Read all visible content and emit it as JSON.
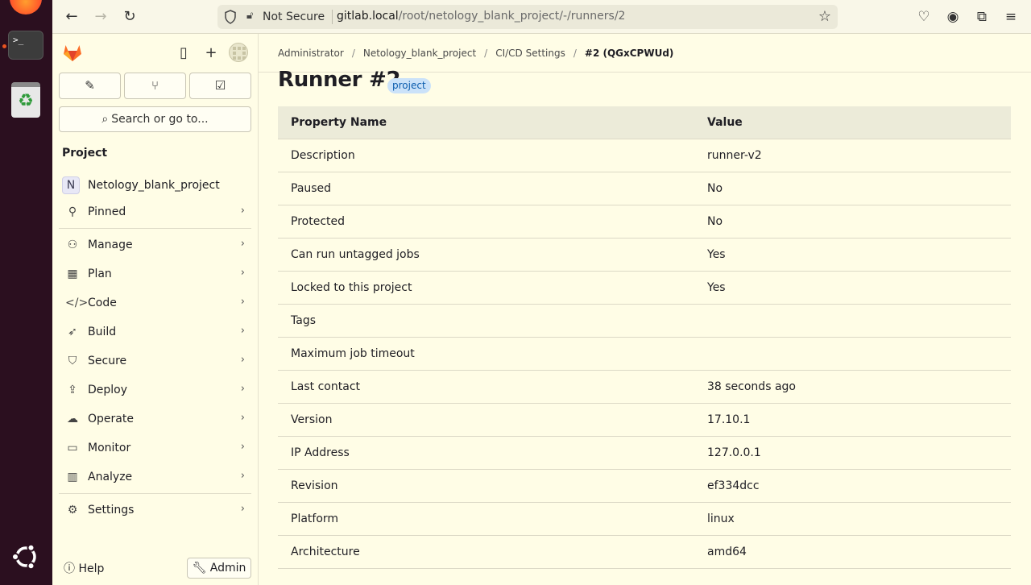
{
  "browser": {
    "security_label": "Not Secure",
    "url_host": "gitlab.local",
    "url_path": "/root/netology_blank_project/-/runners/2"
  },
  "sidebar": {
    "search_label": "Search or go to...",
    "section_heading": "Project",
    "project_initial": "N",
    "project_name": "Netology_blank_project",
    "items": [
      {
        "label": "Pinned",
        "icon": "pin-icon"
      },
      {
        "label": "Manage",
        "icon": "users-icon"
      },
      {
        "label": "Plan",
        "icon": "calendar-icon"
      },
      {
        "label": "Code",
        "icon": "code-icon"
      },
      {
        "label": "Build",
        "icon": "rocket-icon"
      },
      {
        "label": "Secure",
        "icon": "shield-icon"
      },
      {
        "label": "Deploy",
        "icon": "deploy-icon"
      },
      {
        "label": "Operate",
        "icon": "cloud-gear-icon"
      },
      {
        "label": "Monitor",
        "icon": "monitor-icon"
      },
      {
        "label": "Analyze",
        "icon": "chart-icon"
      },
      {
        "label": "Settings",
        "icon": "gear-icon"
      }
    ],
    "help_label": "Help",
    "admin_label": "Admin"
  },
  "breadcrumbs": [
    "Administrator",
    "Netology_blank_project",
    "CI/CD Settings",
    "#2 (QGxCPWUd)"
  ],
  "page": {
    "title": "Runner #2",
    "badge": "project"
  },
  "table": {
    "headers": [
      "Property Name",
      "Value"
    ],
    "rows": [
      [
        "Description",
        "runner-v2"
      ],
      [
        "Paused",
        "No"
      ],
      [
        "Protected",
        "No"
      ],
      [
        "Can run untagged jobs",
        "Yes"
      ],
      [
        "Locked to this project",
        "Yes"
      ],
      [
        "Tags",
        ""
      ],
      [
        "Maximum job timeout",
        ""
      ],
      [
        "Last contact",
        "38 seconds ago"
      ],
      [
        "Version",
        "17.10.1"
      ],
      [
        "IP Address",
        "127.0.0.1"
      ],
      [
        "Revision",
        "ef334dcc"
      ],
      [
        "Platform",
        "linux"
      ],
      [
        "Architecture",
        "amd64"
      ]
    ]
  },
  "colors": {
    "background": "#fffde6",
    "badge_bg": "#cbe2f9",
    "badge_text": "#0b5cad",
    "table_header_bg": "#ecebd9"
  }
}
